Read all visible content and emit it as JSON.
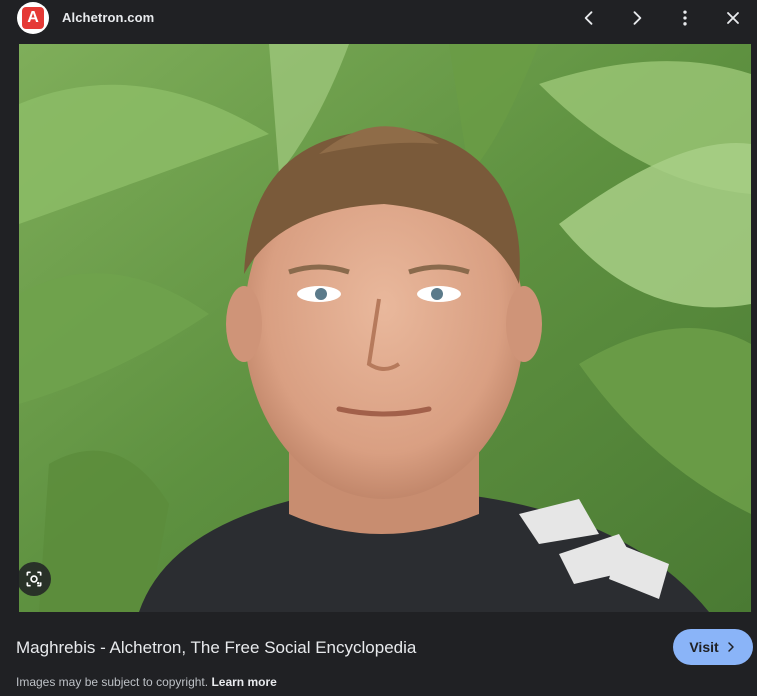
{
  "header": {
    "site_name": "Alchetron.com",
    "logo_letter": "A",
    "icons": [
      "back-arrow-icon",
      "forward-arrow-icon",
      "more-vert-icon",
      "close-icon"
    ]
  },
  "preview": {
    "title": "Maghrebis - Alchetron, The Free Social Encyclopedia",
    "visit_label": "Visit",
    "copyright_text": "Images may be subject to copyright.",
    "learn_more_label": "Learn more"
  },
  "colors": {
    "background": "#202124",
    "accent": "#8ab4f8",
    "logo_red": "#e53935"
  }
}
